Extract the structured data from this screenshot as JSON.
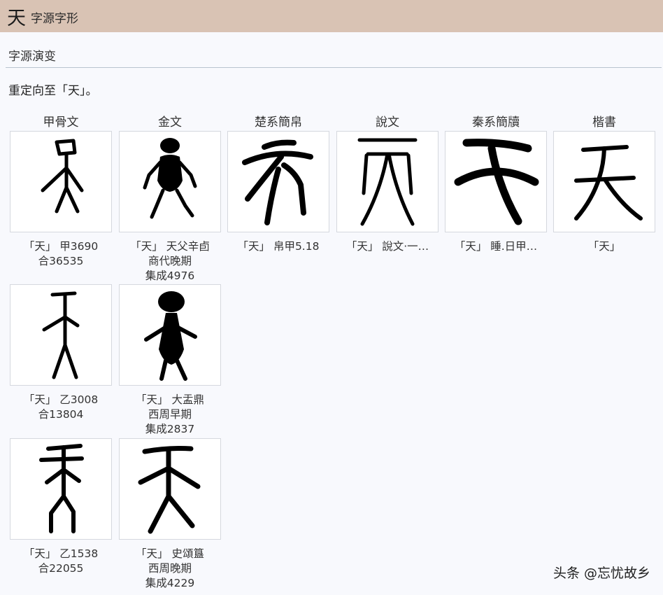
{
  "header": {
    "char": "天",
    "title": "字源字形"
  },
  "section": {
    "title": "字源演变",
    "redirect": "重定向至「天」。"
  },
  "columns": [
    "甲骨文",
    "金文",
    "楚系簡帛",
    "說文",
    "秦系簡牘",
    "楷書"
  ],
  "glyph_cells": [
    {
      "id": "jgw1",
      "caption": [
        "「天」 甲3690",
        "合36535"
      ]
    },
    {
      "id": "jw1",
      "caption": [
        "「天」 天父辛卣",
        "商代晚期",
        "集成4976"
      ]
    },
    {
      "id": "cx1",
      "caption": [
        "「天」 帛甲5.18"
      ]
    },
    {
      "id": "sw1",
      "caption": [
        "「天」 說文‧一…"
      ]
    },
    {
      "id": "qx1",
      "caption": [
        "「天」 睡.日甲…"
      ]
    },
    {
      "id": "ks1",
      "caption": [
        "「天」"
      ]
    },
    {
      "id": "jgw2",
      "caption": [
        "「天」 乙3008",
        "合13804"
      ]
    },
    {
      "id": "jw2",
      "caption": [
        "「天」 大盂鼎",
        "西周早期",
        "集成2837"
      ]
    },
    {
      "id": "jgw3",
      "caption": [
        "「天」 乙1538",
        "合22055"
      ]
    },
    {
      "id": "jw3",
      "caption": [
        "「天」 史頌簋",
        "西周晚期",
        "集成4229"
      ]
    }
  ],
  "watermark": "头条 @忘忧故乡"
}
